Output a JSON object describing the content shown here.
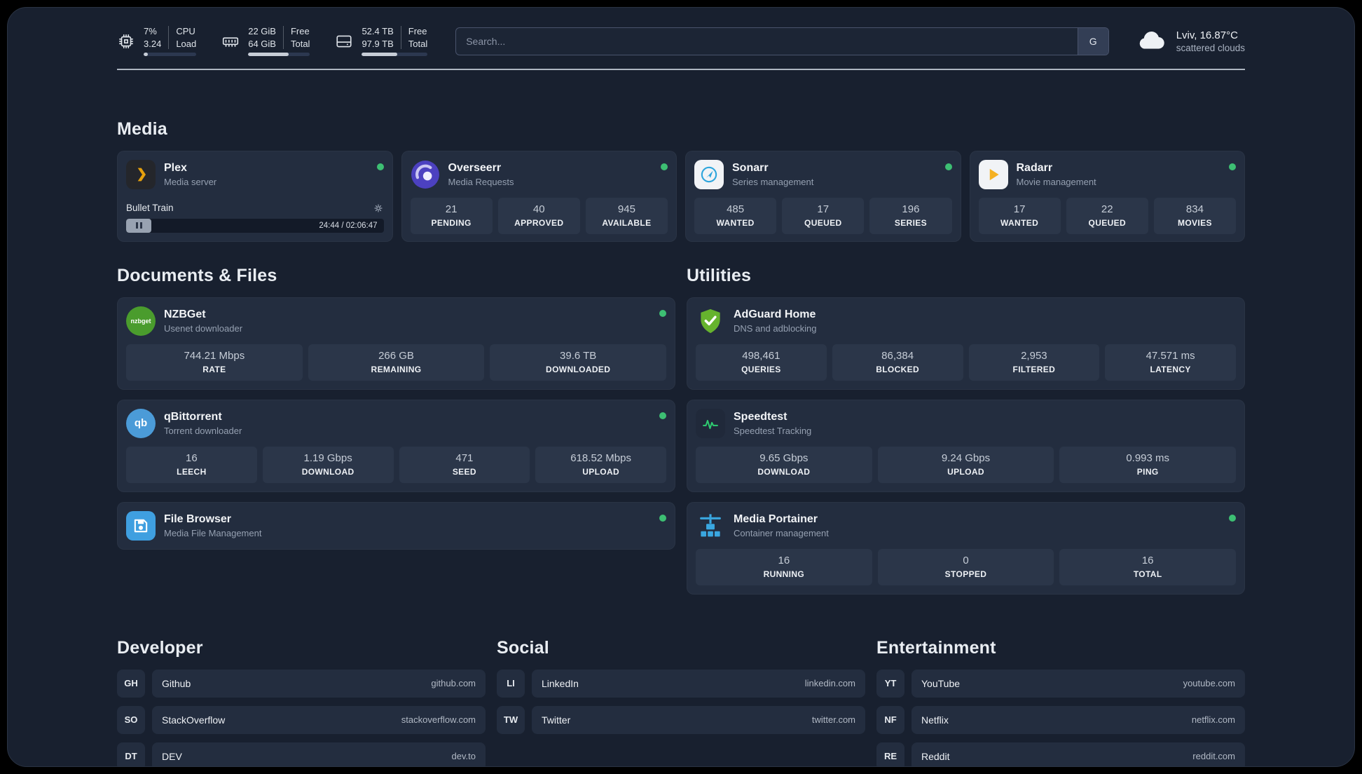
{
  "topbar": {
    "stats": [
      {
        "icon": "cpu-icon",
        "values": [
          "7%",
          "3.24"
        ],
        "labels": [
          "CPU",
          "Load"
        ],
        "progress": 8
      },
      {
        "icon": "ram-icon",
        "values": [
          "22 GiB",
          "64 GiB"
        ],
        "labels": [
          "Free",
          "Total"
        ],
        "progress": 66
      },
      {
        "icon": "disk-icon",
        "values": [
          "52.4 TB",
          "97.9 TB"
        ],
        "labels": [
          "Free",
          "Total"
        ],
        "progress": 54
      }
    ],
    "search": {
      "placeholder": "Search...",
      "button_label": "G"
    },
    "weather": {
      "location": "Lviv, 16.87°C",
      "condition": "scattered clouds"
    }
  },
  "sections": {
    "media": {
      "title": "Media",
      "plex": {
        "name": "Plex",
        "subtitle": "Media server",
        "now_playing": "Bullet Train",
        "time": "24:44 / 02:06:47"
      },
      "overseerr": {
        "name": "Overseerr",
        "subtitle": "Media Requests",
        "stats": [
          {
            "value": "21",
            "label": "PENDING"
          },
          {
            "value": "40",
            "label": "APPROVED"
          },
          {
            "value": "945",
            "label": "AVAILABLE"
          }
        ]
      },
      "sonarr": {
        "name": "Sonarr",
        "subtitle": "Series management",
        "stats": [
          {
            "value": "485",
            "label": "WANTED"
          },
          {
            "value": "17",
            "label": "QUEUED"
          },
          {
            "value": "196",
            "label": "SERIES"
          }
        ]
      },
      "radarr": {
        "name": "Radarr",
        "subtitle": "Movie management",
        "stats": [
          {
            "value": "17",
            "label": "WANTED"
          },
          {
            "value": "22",
            "label": "QUEUED"
          },
          {
            "value": "834",
            "label": "MOVIES"
          }
        ]
      }
    },
    "documents": {
      "title": "Documents & Files",
      "nzbget": {
        "name": "NZBGet",
        "subtitle": "Usenet downloader",
        "stats": [
          {
            "value": "744.21 Mbps",
            "label": "RATE"
          },
          {
            "value": "266 GB",
            "label": "REMAINING"
          },
          {
            "value": "39.6 TB",
            "label": "DOWNLOADED"
          }
        ]
      },
      "qbittorrent": {
        "name": "qBittorrent",
        "subtitle": "Torrent downloader",
        "stats": [
          {
            "value": "16",
            "label": "LEECH"
          },
          {
            "value": "1.19 Gbps",
            "label": "DOWNLOAD"
          },
          {
            "value": "471",
            "label": "SEED"
          },
          {
            "value": "618.52 Mbps",
            "label": "UPLOAD"
          }
        ]
      },
      "filebrowser": {
        "name": "File Browser",
        "subtitle": "Media File Management"
      }
    },
    "utilities": {
      "title": "Utilities",
      "adguard": {
        "name": "AdGuard Home",
        "subtitle": "DNS and adblocking",
        "stats": [
          {
            "value": "498,461",
            "label": "QUERIES"
          },
          {
            "value": "86,384",
            "label": "BLOCKED"
          },
          {
            "value": "2,953",
            "label": "FILTERED"
          },
          {
            "value": "47.571 ms",
            "label": "LATENCY"
          }
        ]
      },
      "speedtest": {
        "name": "Speedtest",
        "subtitle": "Speedtest Tracking",
        "stats": [
          {
            "value": "9.65 Gbps",
            "label": "DOWNLOAD"
          },
          {
            "value": "9.24 Gbps",
            "label": "UPLOAD"
          },
          {
            "value": "0.993 ms",
            "label": "PING"
          }
        ]
      },
      "portainer": {
        "name": "Media Portainer",
        "subtitle": "Container management",
        "stats": [
          {
            "value": "16",
            "label": "RUNNING"
          },
          {
            "value": "0",
            "label": "STOPPED"
          },
          {
            "value": "16",
            "label": "TOTAL"
          }
        ]
      }
    }
  },
  "links": [
    {
      "title": "Developer",
      "items": [
        {
          "abbr": "GH",
          "name": "Github",
          "url": "github.com"
        },
        {
          "abbr": "SO",
          "name": "StackOverflow",
          "url": "stackoverflow.com"
        },
        {
          "abbr": "DT",
          "name": "DEV",
          "url": "dev.to"
        }
      ]
    },
    {
      "title": "Social",
      "items": [
        {
          "abbr": "LI",
          "name": "LinkedIn",
          "url": "linkedin.com"
        },
        {
          "abbr": "TW",
          "name": "Twitter",
          "url": "twitter.com"
        }
      ]
    },
    {
      "title": "Entertainment",
      "items": [
        {
          "abbr": "YT",
          "name": "YouTube",
          "url": "youtube.com"
        },
        {
          "abbr": "NF",
          "name": "Netflix",
          "url": "netflix.com"
        },
        {
          "abbr": "RE",
          "name": "Reddit",
          "url": "reddit.com"
        }
      ]
    }
  ],
  "icon_labels": {
    "nzbget": "nzbget",
    "qbittorrent": "qb"
  },
  "colors": {
    "bg": "#18202f",
    "card": "#232d3f",
    "stat": "#2b3649",
    "accent-green": "#3dbf73",
    "plex-amber": "#e5a00d",
    "sonarr-blue": "#2da5dc",
    "radarr-amber": "#f5b123",
    "nzbget-green": "#4a9c2d",
    "qbittorrent-blue": "#4b9bd8",
    "filebrowser-blue": "#3f9fe0",
    "adguard-green": "#66b32e",
    "speedtest-green": "#2ecc71",
    "portainer-blue": "#3aa7e0"
  }
}
